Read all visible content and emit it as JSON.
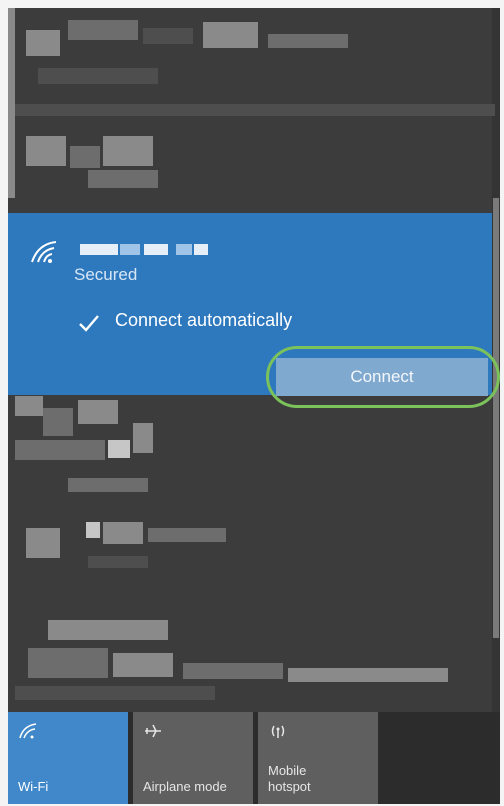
{
  "network": {
    "status": "Secured",
    "auto_connect_label": "Connect automatically",
    "connect_button": "Connect"
  },
  "quick_actions": [
    {
      "label": "Wi-Fi",
      "icon": "wifi-icon",
      "active": true
    },
    {
      "label": "Airplane mode",
      "icon": "airplane-icon",
      "active": false
    },
    {
      "label": "Mobile hotspot",
      "icon": "hotspot-icon",
      "active": false
    }
  ],
  "colors": {
    "accent": "#2e79bd",
    "panel_bg": "#3c3c3c",
    "highlight": "#7cc25b"
  }
}
